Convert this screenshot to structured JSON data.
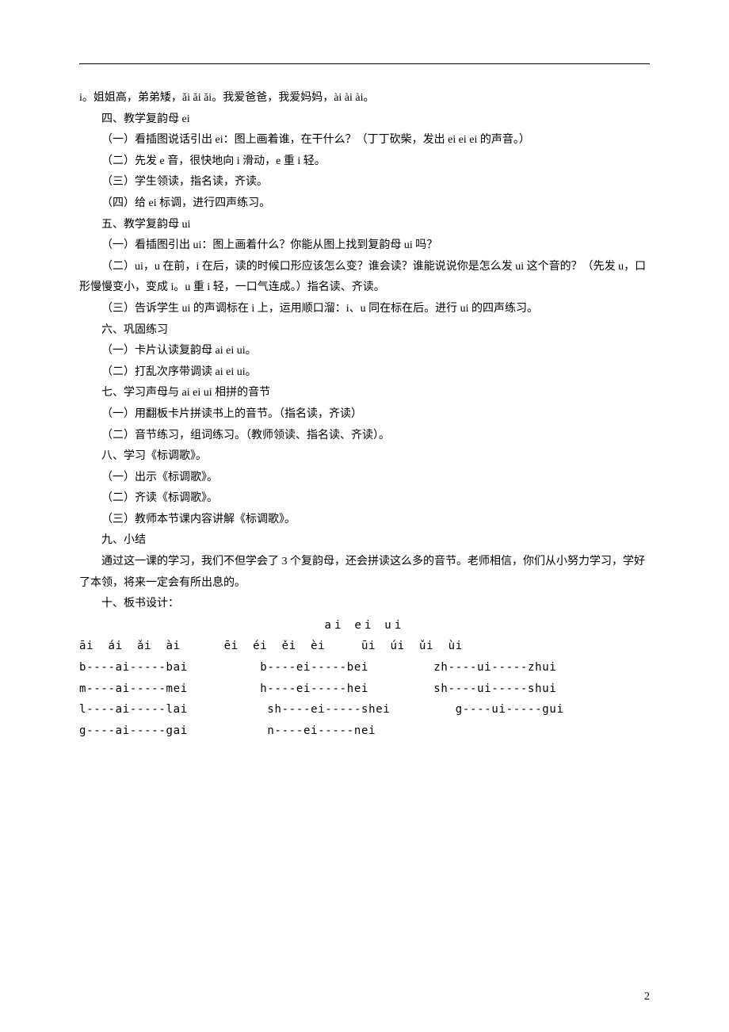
{
  "p1": "i。姐姐高，弟弟矮，ǎi  ǎi  ǎi。我爱爸爸，我爱妈妈，ài  ài  ài。",
  "sec4_title": "四、教学复韵母 ei",
  "sec4_1": "（一）看插图说话引出 ei：图上画着谁，在干什么？（丁丁砍柴，发出 ei  ei  ei 的声音。）",
  "sec4_2": "（二）先发 e 音，很快地向 i 滑动，e 重 i 轻。",
  "sec4_3": "（三）学生领读，指名读，齐读。",
  "sec4_4": "（四）给 ei 标调，进行四声练习。",
  "sec5_title": "五、教学复韵母 ui",
  "sec5_1": "（一）看插图引出 ui：图上画着什么？你能从图上找到复韵母 ui 吗？",
  "sec5_2": "（二）ui，u 在前，i 在后，读的时候口形应该怎么变？谁会读？谁能说说你是怎么发 ui 这个音的？（先发 u，口形慢慢变小，变成 i。u 重 i 轻，一口气连成。）指名读、齐读。",
  "sec5_3": "（三）告诉学生 ui 的声调标在 i 上，运用顺口溜：i、u 同在标在后。进行 ui 的四声练习。",
  "sec6_title": "六、巩固练习",
  "sec6_1": "（一）卡片认读复韵母 ai  ei  ui。",
  "sec6_2": "（二）打乱次序带调读 ai  ei  ui。",
  "sec7_title": "七、学习声母与 ai  ei  ui 相拼的音节",
  "sec7_1": "（一）用翻板卡片拼读书上的音节。（指名读，齐读）",
  "sec7_2": "（二）音节练习，组词练习。（教师领读、指名读、齐读）。",
  "sec8_title": "八、学习《标调歌》。",
  "sec8_1": "（一）出示《标调歌》。",
  "sec8_2": "（二）齐读《标调歌》。",
  "sec8_3": "（三）教师本节课内容讲解《标调歌》。",
  "sec9_title": "九、小结",
  "sec9_body": "通过这一课的学习，我们不但学会了 3 个复韵母，还会拼读这么多的音节。老师相信，你们从小努力学习，学好了本领，将来一定会有所出息的。",
  "sec10_title": "十、板书设计：",
  "board_title": "ai   ei   ui",
  "board_row1": "āi  ái  ǎi  ài      ēi  éi  ěi  èi     ūi  úi  ǔi  ùi",
  "board_row2": "b----ai-----bai          b----ei-----bei         zh----ui-----zhui",
  "board_row3": "m----ai-----mei          h----ei-----hei         sh----ui-----shui",
  "board_row4": "l----ai-----lai           sh----ei-----shei         g----ui-----gui",
  "board_row5": "g----ai-----gai           n----ei-----nei",
  "page_number": "2"
}
